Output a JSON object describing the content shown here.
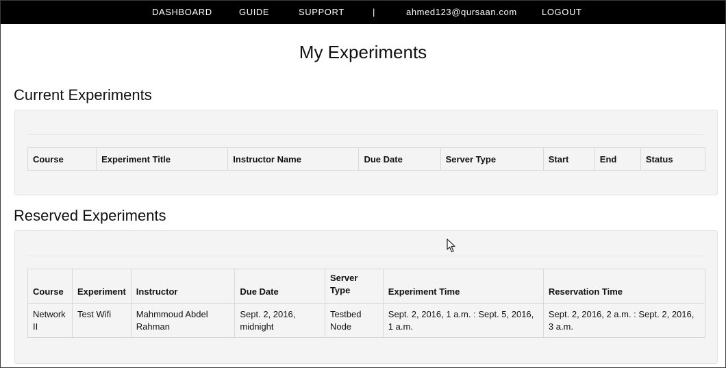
{
  "nav": {
    "dashboard": "DASHBOARD",
    "guide": "GUIDE",
    "support": "SUPPORT",
    "separator": "|",
    "user_email": "ahmed123@qursaan.com",
    "logout": "LOGOUT"
  },
  "page": {
    "title": "My Experiments"
  },
  "current": {
    "title": "Current Experiments",
    "columns": [
      "Course",
      "Experiment Title",
      "Instructor Name",
      "Due Date",
      "Server Type",
      "Start",
      "End",
      "Status"
    ],
    "rows": []
  },
  "reserved": {
    "title": "Reserved Experiments",
    "columns": [
      "Course",
      "Experiment",
      "Instructor",
      "Due Date",
      "Server Type",
      "Experiment Time",
      "Reservation Time"
    ],
    "rows": [
      {
        "course": "Network II",
        "experiment": "Test Wifi",
        "instructor": "Mahmmoud Abdel Rahman",
        "due_date": "Sept. 2, 2016, midnight",
        "server_type": "Testbed Node",
        "experiment_time": "Sept. 2, 2016, 1 a.m. : Sept. 5, 2016, 1 a.m.",
        "reservation_time": "Sept. 2, 2016, 2 a.m. : Sept. 2, 2016, 3 a.m."
      }
    ]
  },
  "colors": {
    "navbar": "#000000",
    "panel": "#f4f4f4",
    "border": "#d8d8d8"
  },
  "icons": {
    "cursor": "mouse-pointer-icon"
  }
}
